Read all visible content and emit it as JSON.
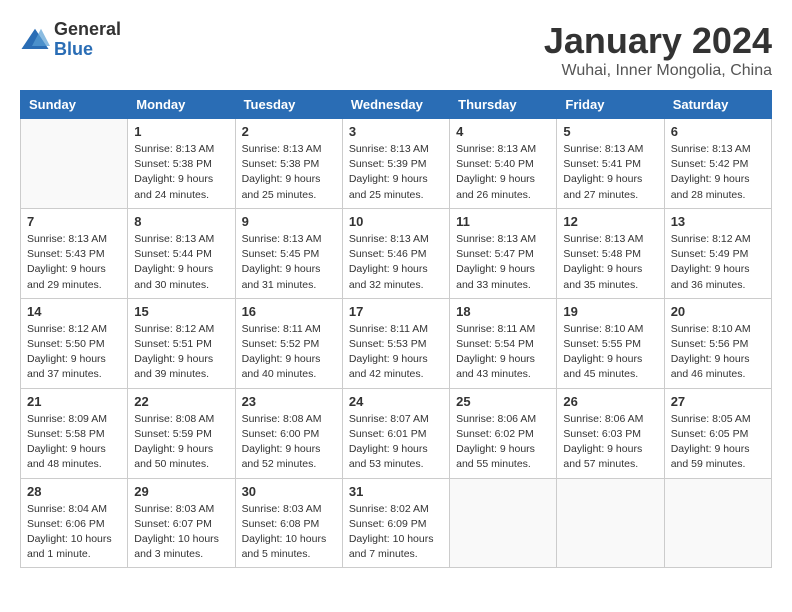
{
  "logo": {
    "general": "General",
    "blue": "Blue"
  },
  "title": "January 2024",
  "location": "Wuhai, Inner Mongolia, China",
  "weekdays": [
    "Sunday",
    "Monday",
    "Tuesday",
    "Wednesday",
    "Thursday",
    "Friday",
    "Saturday"
  ],
  "weeks": [
    [
      {
        "day": "",
        "info": ""
      },
      {
        "day": "1",
        "info": "Sunrise: 8:13 AM\nSunset: 5:38 PM\nDaylight: 9 hours\nand 24 minutes."
      },
      {
        "day": "2",
        "info": "Sunrise: 8:13 AM\nSunset: 5:38 PM\nDaylight: 9 hours\nand 25 minutes."
      },
      {
        "day": "3",
        "info": "Sunrise: 8:13 AM\nSunset: 5:39 PM\nDaylight: 9 hours\nand 25 minutes."
      },
      {
        "day": "4",
        "info": "Sunrise: 8:13 AM\nSunset: 5:40 PM\nDaylight: 9 hours\nand 26 minutes."
      },
      {
        "day": "5",
        "info": "Sunrise: 8:13 AM\nSunset: 5:41 PM\nDaylight: 9 hours\nand 27 minutes."
      },
      {
        "day": "6",
        "info": "Sunrise: 8:13 AM\nSunset: 5:42 PM\nDaylight: 9 hours\nand 28 minutes."
      }
    ],
    [
      {
        "day": "7",
        "info": "Sunrise: 8:13 AM\nSunset: 5:43 PM\nDaylight: 9 hours\nand 29 minutes."
      },
      {
        "day": "8",
        "info": "Sunrise: 8:13 AM\nSunset: 5:44 PM\nDaylight: 9 hours\nand 30 minutes."
      },
      {
        "day": "9",
        "info": "Sunrise: 8:13 AM\nSunset: 5:45 PM\nDaylight: 9 hours\nand 31 minutes."
      },
      {
        "day": "10",
        "info": "Sunrise: 8:13 AM\nSunset: 5:46 PM\nDaylight: 9 hours\nand 32 minutes."
      },
      {
        "day": "11",
        "info": "Sunrise: 8:13 AM\nSunset: 5:47 PM\nDaylight: 9 hours\nand 33 minutes."
      },
      {
        "day": "12",
        "info": "Sunrise: 8:13 AM\nSunset: 5:48 PM\nDaylight: 9 hours\nand 35 minutes."
      },
      {
        "day": "13",
        "info": "Sunrise: 8:12 AM\nSunset: 5:49 PM\nDaylight: 9 hours\nand 36 minutes."
      }
    ],
    [
      {
        "day": "14",
        "info": "Sunrise: 8:12 AM\nSunset: 5:50 PM\nDaylight: 9 hours\nand 37 minutes."
      },
      {
        "day": "15",
        "info": "Sunrise: 8:12 AM\nSunset: 5:51 PM\nDaylight: 9 hours\nand 39 minutes."
      },
      {
        "day": "16",
        "info": "Sunrise: 8:11 AM\nSunset: 5:52 PM\nDaylight: 9 hours\nand 40 minutes."
      },
      {
        "day": "17",
        "info": "Sunrise: 8:11 AM\nSunset: 5:53 PM\nDaylight: 9 hours\nand 42 minutes."
      },
      {
        "day": "18",
        "info": "Sunrise: 8:11 AM\nSunset: 5:54 PM\nDaylight: 9 hours\nand 43 minutes."
      },
      {
        "day": "19",
        "info": "Sunrise: 8:10 AM\nSunset: 5:55 PM\nDaylight: 9 hours\nand 45 minutes."
      },
      {
        "day": "20",
        "info": "Sunrise: 8:10 AM\nSunset: 5:56 PM\nDaylight: 9 hours\nand 46 minutes."
      }
    ],
    [
      {
        "day": "21",
        "info": "Sunrise: 8:09 AM\nSunset: 5:58 PM\nDaylight: 9 hours\nand 48 minutes."
      },
      {
        "day": "22",
        "info": "Sunrise: 8:08 AM\nSunset: 5:59 PM\nDaylight: 9 hours\nand 50 minutes."
      },
      {
        "day": "23",
        "info": "Sunrise: 8:08 AM\nSunset: 6:00 PM\nDaylight: 9 hours\nand 52 minutes."
      },
      {
        "day": "24",
        "info": "Sunrise: 8:07 AM\nSunset: 6:01 PM\nDaylight: 9 hours\nand 53 minutes."
      },
      {
        "day": "25",
        "info": "Sunrise: 8:06 AM\nSunset: 6:02 PM\nDaylight: 9 hours\nand 55 minutes."
      },
      {
        "day": "26",
        "info": "Sunrise: 8:06 AM\nSunset: 6:03 PM\nDaylight: 9 hours\nand 57 minutes."
      },
      {
        "day": "27",
        "info": "Sunrise: 8:05 AM\nSunset: 6:05 PM\nDaylight: 9 hours\nand 59 minutes."
      }
    ],
    [
      {
        "day": "28",
        "info": "Sunrise: 8:04 AM\nSunset: 6:06 PM\nDaylight: 10 hours\nand 1 minute."
      },
      {
        "day": "29",
        "info": "Sunrise: 8:03 AM\nSunset: 6:07 PM\nDaylight: 10 hours\nand 3 minutes."
      },
      {
        "day": "30",
        "info": "Sunrise: 8:03 AM\nSunset: 6:08 PM\nDaylight: 10 hours\nand 5 minutes."
      },
      {
        "day": "31",
        "info": "Sunrise: 8:02 AM\nSunset: 6:09 PM\nDaylight: 10 hours\nand 7 minutes."
      },
      {
        "day": "",
        "info": ""
      },
      {
        "day": "",
        "info": ""
      },
      {
        "day": "",
        "info": ""
      }
    ]
  ]
}
